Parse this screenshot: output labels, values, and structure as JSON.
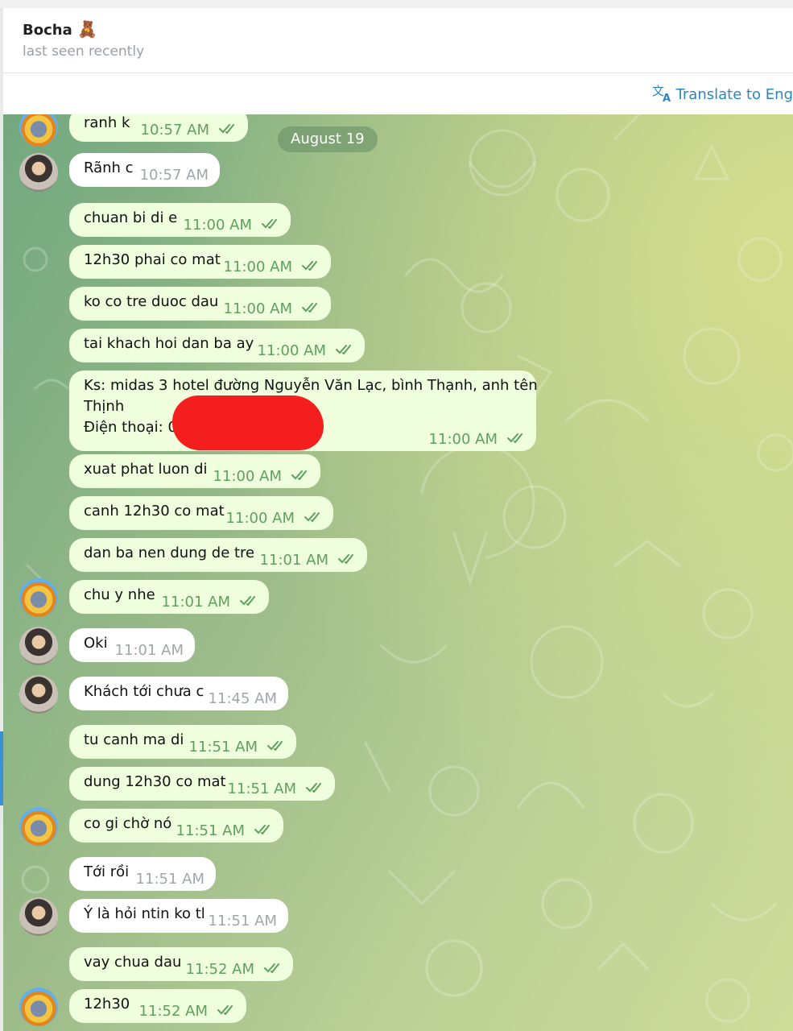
{
  "header": {
    "name": "Bocha",
    "emoji": "🧸",
    "status": "last seen recently"
  },
  "translate": {
    "label": "Translate to Eng"
  },
  "date_separator": "August 19",
  "messages": [
    {
      "text": "ranh k",
      "time": "10:57 AM",
      "outgoing": true
    },
    {
      "text": "Rãnh c",
      "time": "10:57 AM",
      "outgoing": false
    },
    {
      "text": "chuan bi di e",
      "time": "11:00 AM",
      "outgoing": true
    },
    {
      "text": "12h30 phai co mat",
      "time": "11:00 AM",
      "outgoing": true
    },
    {
      "text": "ko co tre duoc dau",
      "time": "11:00 AM",
      "outgoing": true
    },
    {
      "text": "tai khach hoi dan ba ay",
      "time": "11:00 AM",
      "outgoing": true
    },
    {
      "line1": "Ks: midas 3 hotel đường Nguyễn Văn Lạc, bình Thạnh, anh tên",
      "line2": "Thịnh",
      "line3": "Điện thoại: 0",
      "time": "11:00 AM",
      "outgoing": true
    },
    {
      "text": "xuat phat luon di",
      "time": "11:00 AM",
      "outgoing": true
    },
    {
      "text": "canh 12h30 co mat",
      "time": "11:00 AM",
      "outgoing": true
    },
    {
      "text": "dan ba nen dung de tre",
      "time": "11:01 AM",
      "outgoing": true
    },
    {
      "text": "chu y nhe",
      "time": "11:01 AM",
      "outgoing": true
    },
    {
      "text": "Oki",
      "time": "11:01 AM",
      "outgoing": false
    },
    {
      "text": "Khách tới chưa c",
      "time": "11:45 AM",
      "outgoing": false
    },
    {
      "text": "tu canh ma di",
      "time": "11:51 AM",
      "outgoing": true
    },
    {
      "text": "dung 12h30 co mat",
      "time": "11:51 AM",
      "outgoing": true
    },
    {
      "text": "co gi chờ nó",
      "time": "11:51 AM",
      "outgoing": true
    },
    {
      "text": "Tới rồi",
      "time": "11:51 AM",
      "outgoing": false
    },
    {
      "text": "Ý là hỏi ntin ko tl",
      "time": "11:51 AM",
      "outgoing": false
    },
    {
      "text": "vay chua dau",
      "time": "11:52 AM",
      "outgoing": true
    },
    {
      "text": "12h30",
      "time": "11:52 AM",
      "outgoing": true
    }
  ],
  "colors": {
    "outgoing_bubble": "#effedd",
    "incoming_bubble": "#ffffff",
    "check": "#5fa05e",
    "link": "#2e86c1",
    "redaction": "#f51e1e"
  },
  "icons": {
    "translate": "translate-icon",
    "read_receipt": "double-check-icon"
  }
}
